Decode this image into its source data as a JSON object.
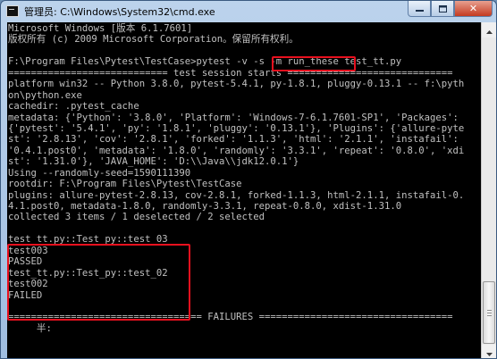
{
  "window": {
    "title": "管理员: C:\\Windows\\System32\\cmd.exe",
    "app_icon": "console-icon",
    "controls": {
      "minimize_icon": "minimize-icon",
      "maximize_icon": "maximize-icon",
      "close_glyph": "✕",
      "close_icon": "close-icon"
    }
  },
  "console": {
    "text_color": "#c0c0c0",
    "background": "#000000",
    "lines": [
      "Microsoft Windows [版本 6.1.7601]",
      "版权所有 (c) 2009 Microsoft Corporation。保留所有权利。",
      "",
      "F:\\Program Files\\Pytest\\TestCase>pytest -v -s -m run_these test_tt.py",
      "============================ test session starts =============================",
      "platform win32 -- Python 3.8.0, pytest-5.4.1, py-1.8.1, pluggy-0.13.1 -- f:\\pyth",
      "on\\python.exe",
      "cachedir: .pytest_cache",
      "metadata: {'Python': '3.8.0', 'Platform': 'Windows-7-6.1.7601-SP1', 'Packages':",
      "{'pytest': '5.4.1', 'py': '1.8.1', 'pluggy': '0.13.1'}, 'Plugins': {'allure-pyte",
      "st': '2.8.13', 'cov': '2.8.1', 'forked': '1.1.3', 'html': '2.1.1', 'instafail':",
      "'0.4.1.post0', 'metadata': '1.8.0', 'randomly': '3.3.1', 'repeat': '0.8.0', 'xdi",
      "st': '1.31.0'}, 'JAVA_HOME': 'D:\\\\Java\\\\jdk12.0.1'}",
      "Using --randomly-seed=1590111390",
      "rootdir: F:\\Program Files\\Pytest\\TestCase",
      "plugins: allure-pytest-2.8.13, cov-2.8.1, forked-1.1.3, html-2.1.1, instafail-0.",
      "4.1.post0, metadata-1.8.0, randomly-3.3.1, repeat-0.8.0, xdist-1.31.0",
      "collected 3 items / 1 deselected / 2 selected",
      "",
      "test_tt.py::Test_py::test_03",
      "test003",
      "PASSED",
      "test_tt.py::Test_py::test_02",
      "test002",
      "FAILED",
      "",
      "================================== FAILURES ==================================",
      "     半:"
    ]
  },
  "annotations": {
    "color": "#e8101e"
  },
  "scrollbar": {
    "up_icon": "arrow-up-icon",
    "down_icon": "arrow-down-icon"
  }
}
